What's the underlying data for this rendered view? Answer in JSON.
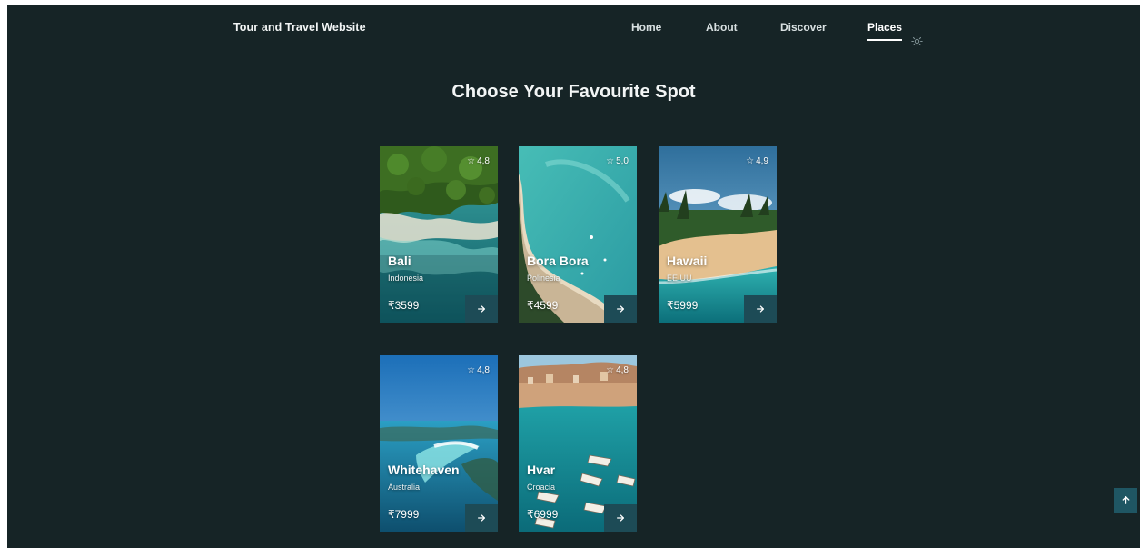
{
  "header": {
    "logo": "Tour and Travel Website",
    "nav": [
      {
        "label": "Home"
      },
      {
        "label": "About"
      },
      {
        "label": "Discover"
      },
      {
        "label": "Places",
        "active": true
      }
    ],
    "theme_icon": "sun-icon"
  },
  "section": {
    "title": "Choose Your Favourite Spot"
  },
  "places": [
    {
      "name": "Bali",
      "country": "Indonesia",
      "rating": "4,8",
      "price": "₹3599"
    },
    {
      "name": "Bora Bora",
      "country": "Polinesia",
      "rating": "5,0",
      "price": "₹4599"
    },
    {
      "name": "Hawaii",
      "country": "EE.UU",
      "rating": "4,9",
      "price": "₹5999"
    },
    {
      "name": "Whitehaven",
      "country": "Australia",
      "rating": "4,8",
      "price": "₹7999"
    },
    {
      "name": "Hvar",
      "country": "Croacia",
      "rating": "4,8",
      "price": "₹6999"
    }
  ],
  "icons": {
    "star": "star-icon",
    "arrow": "arrow-right-icon",
    "scroll": "arrow-up-icon"
  },
  "colors": {
    "background": "#162426",
    "button": "#1d4b56",
    "scroll_button": "#1f5663",
    "text": "#f2f5f5"
  }
}
